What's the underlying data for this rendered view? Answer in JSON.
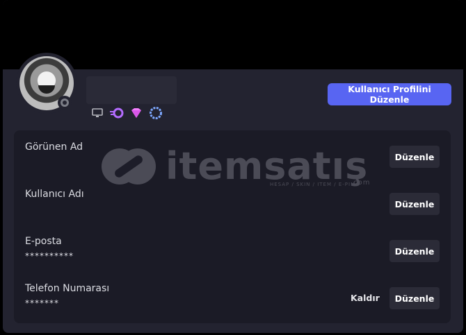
{
  "profile": {
    "edit_profile_label": "Kullanıcı Profilini Düzenle",
    "badges": [
      "monitor-icon",
      "nitro-icon",
      "boost-gem-icon",
      "laurel-badge-icon"
    ]
  },
  "account": {
    "fields": [
      {
        "label": "Görünen Ad",
        "value": "",
        "edit_label": "Düzenle"
      },
      {
        "label": "Kullanıcı Adı",
        "value": "",
        "edit_label": "Düzenle"
      },
      {
        "label": "E-posta",
        "value": "**********",
        "edit_label": "Düzenle"
      },
      {
        "label": "Telefon Numarası",
        "value": "*******",
        "edit_label": "Düzenle",
        "remove_label": "Kaldır"
      }
    ]
  },
  "watermark": {
    "text": "itemsatış",
    "subtext": "HESAP / SKIN / ITEM / E-PIN",
    "domain": ".com"
  },
  "colors": {
    "accent": "#5865f2",
    "background": "#232330",
    "panel": "#1b1b26"
  }
}
